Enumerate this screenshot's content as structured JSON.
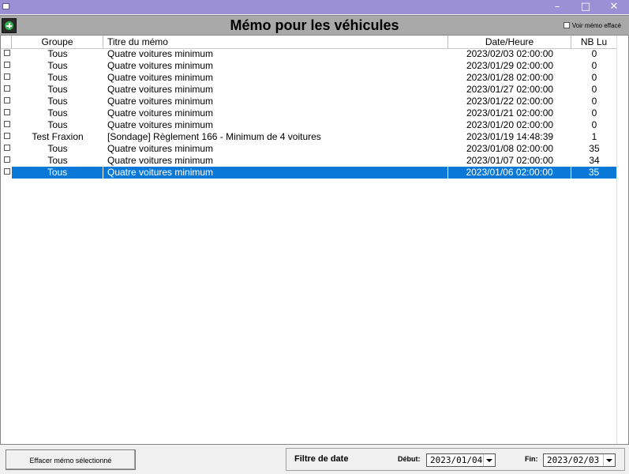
{
  "window": {
    "minimize_glyph": "–",
    "maximize_glyph": "□",
    "close_glyph": "✕"
  },
  "header": {
    "title": "Mémo pour les véhicules",
    "show_deleted_label": "Voir mémo effacé"
  },
  "table": {
    "columns": [
      "Groupe",
      "Titre du mémo",
      "Date/Heure",
      "NB Lu"
    ],
    "rows": [
      {
        "group": "Tous",
        "title": "Quatre voitures minimum",
        "datetime": "2023/02/03 02:00:00",
        "nb_lu": "0"
      },
      {
        "group": "Tous",
        "title": "Quatre voitures minimum",
        "datetime": "2023/01/29 02:00:00",
        "nb_lu": "0"
      },
      {
        "group": "Tous",
        "title": "Quatre voitures minimum",
        "datetime": "2023/01/28 02:00:00",
        "nb_lu": "0"
      },
      {
        "group": "Tous",
        "title": "Quatre voitures minimum",
        "datetime": "2023/01/27 02:00:00",
        "nb_lu": "0"
      },
      {
        "group": "Tous",
        "title": "Quatre voitures minimum",
        "datetime": "2023/01/22 02:00:00",
        "nb_lu": "0"
      },
      {
        "group": "Tous",
        "title": "Quatre voitures minimum",
        "datetime": "2023/01/21 02:00:00",
        "nb_lu": "0"
      },
      {
        "group": "Tous",
        "title": "Quatre voitures minimum",
        "datetime": "2023/01/20 02:00:00",
        "nb_lu": "0"
      },
      {
        "group": "Test Fraxion",
        "title": "[Sondage] Règlement 166 - Minimum de 4 voitures",
        "datetime": "2023/01/19 14:48:39",
        "nb_lu": "1"
      },
      {
        "group": "Tous",
        "title": "Quatre voitures minimum",
        "datetime": "2023/01/08 02:00:00",
        "nb_lu": "35"
      },
      {
        "group": "Tous",
        "title": "Quatre voitures minimum",
        "datetime": "2023/01/07 02:00:00",
        "nb_lu": "34"
      },
      {
        "group": "Tous",
        "title": "Quatre voitures minimum",
        "datetime": "2023/01/06 02:00:00",
        "nb_lu": "35",
        "selected": true
      }
    ]
  },
  "footer": {
    "delete_button_label": "Effacer mémo sélectionné",
    "date_filter_label": "Filtre de date",
    "start_label": "Début:",
    "start_value": "2023/01/04",
    "end_label": "Fin:",
    "end_value": "2023/02/03"
  },
  "colors": {
    "title_bar": "#9b8fd6",
    "header_bar": "#a9a9a9",
    "selection": "#0a78d7",
    "add_icon": "#2fb34a"
  }
}
